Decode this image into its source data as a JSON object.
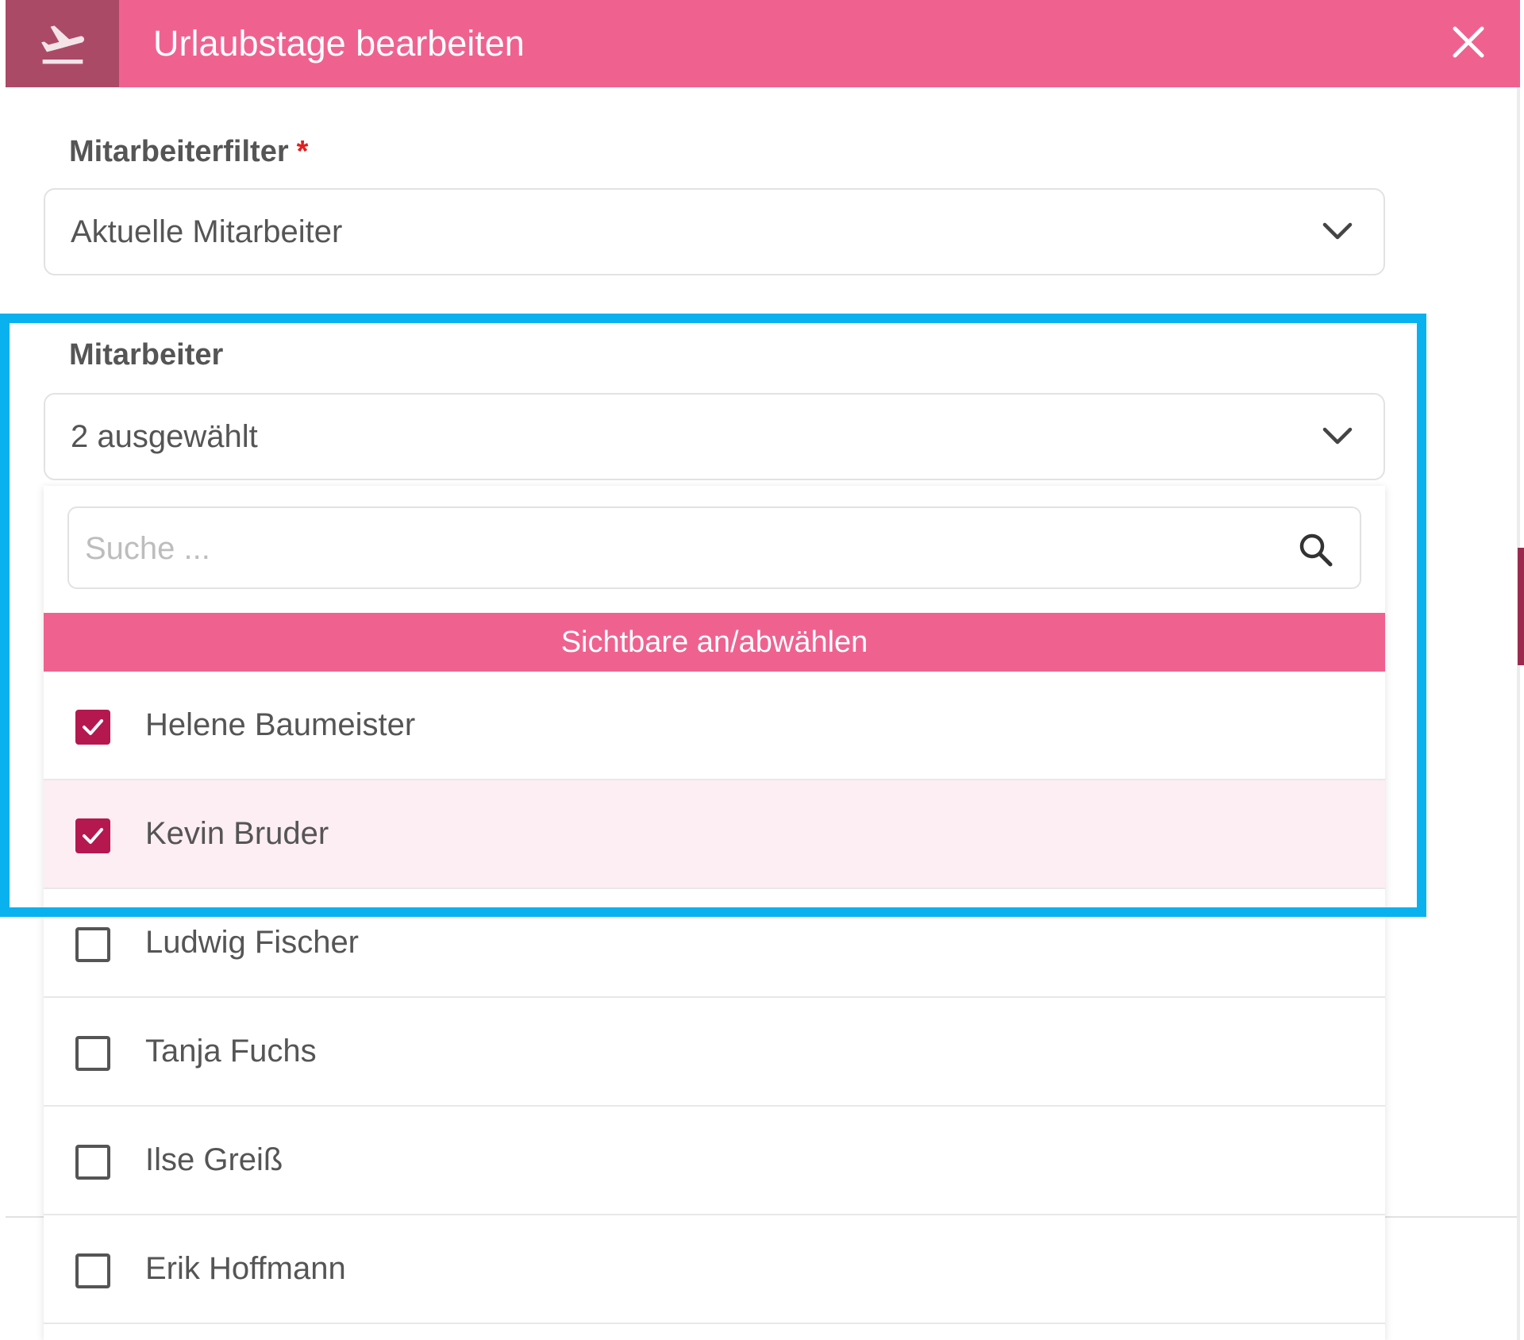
{
  "header": {
    "title": "Urlaubstage bearbeiten",
    "icon": "airplane-departure-icon",
    "close_icon": "close-icon"
  },
  "employee_filter": {
    "label": "Mitarbeiterfilter",
    "required_marker": "*",
    "value": "Aktuelle Mitarbeiter"
  },
  "employees": {
    "label": "Mitarbeiter",
    "value": "2 ausgewählt",
    "search_placeholder": "Suche ...",
    "toggle_visible_label": "Sichtbare an/abwählen",
    "options": [
      {
        "label": "Helene Baumeister",
        "checked": true
      },
      {
        "label": "Kevin Bruder",
        "checked": true
      },
      {
        "label": "Ludwig Fischer",
        "checked": false
      },
      {
        "label": "Tanja Fuchs",
        "checked": false
      },
      {
        "label": "Ilse Greiß",
        "checked": false
      },
      {
        "label": "Erik Hoffmann",
        "checked": false
      }
    ]
  },
  "colors": {
    "brand_pink": "#ef6290",
    "header_icon_bg": "#ab4a67",
    "checkbox_checked": "#b5184f",
    "highlight_frame": "#0ab1ef",
    "hover_row": "#fdeef3"
  }
}
